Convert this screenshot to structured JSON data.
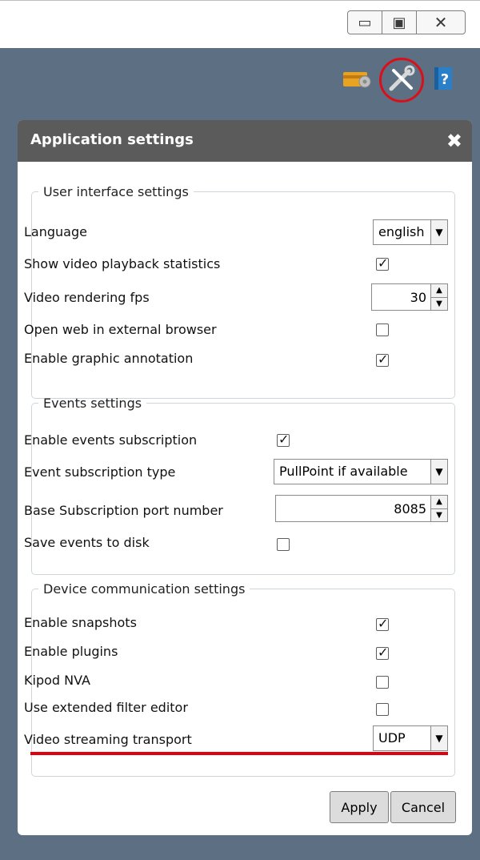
{
  "window_controls": {
    "minimize_symbol": "▭",
    "maximize_symbol": "▣",
    "close_symbol": "✕"
  },
  "header_icons": [
    "card-settings-icon",
    "tools-icon",
    "help-book-icon"
  ],
  "dialog": {
    "title": "Application settings",
    "close_symbol": "✖",
    "ui_settings": {
      "legend": "User interface settings",
      "language_label": "Language",
      "language_value": "english",
      "playback_stats_label": "Show video playback statistics",
      "playback_stats_checked": true,
      "fps_label": "Video rendering fps",
      "fps_value": "30",
      "external_browser_label": "Open web in external browser",
      "external_browser_checked": false,
      "graphic_annotation_label": "Enable graphic annotation",
      "graphic_annotation_checked": true
    },
    "events_settings": {
      "legend": "Events settings",
      "subscription_label": "Enable events subscription",
      "subscription_checked": true,
      "subscription_type_label": "Event subscription type",
      "subscription_type_value": "PullPoint if available",
      "port_label": "Base Subscription port number",
      "port_value": "8085",
      "save_disk_label": "Save events to disk",
      "save_disk_checked": false
    },
    "device_settings": {
      "legend": "Device communication settings",
      "snapshots_label": "Enable snapshots",
      "snapshots_checked": true,
      "plugins_label": "Enable plugins",
      "plugins_checked": true,
      "kipod_label": "Kipod NVA",
      "kipod_checked": false,
      "extended_filter_label": "Use extended filter editor",
      "extended_filter_checked": false,
      "transport_label": "Video streaming transport",
      "transport_value": "UDP"
    },
    "apply_label": "Apply",
    "cancel_label": "Cancel"
  },
  "colors": {
    "background": "#5c6f83",
    "title_bar": "#5b5b5b",
    "highlight": "#d9101a"
  }
}
